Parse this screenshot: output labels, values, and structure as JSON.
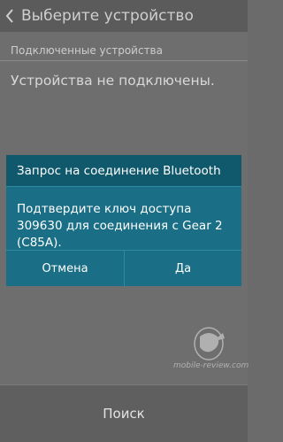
{
  "header": {
    "title": "Выберите устройство"
  },
  "section": {
    "connected_devices_label": "Подключенные устройства",
    "empty_message": "Устройства не подключены."
  },
  "dialog": {
    "title": "Запрос на соединение Bluetooth",
    "message": "Подтвердите ключ доступа 309630 для соединения с Gear 2 (C85A).",
    "cancel_label": "Отмена",
    "ok_label": "Да"
  },
  "watermark": {
    "text": "mobile-review.com"
  },
  "footer": {
    "search_label": "Поиск"
  },
  "colors": {
    "dialog_bg": "#1a6f86",
    "dialog_title_bg": "#10586c",
    "screen_dim": "#6e6e6e"
  }
}
